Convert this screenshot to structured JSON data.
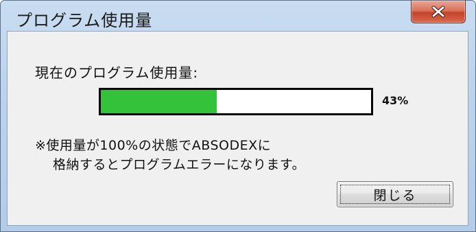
{
  "window": {
    "title": "プログラム使用量"
  },
  "usage": {
    "label": "現在のプログラム使用量:",
    "progress_fraction": 0.43,
    "percent_text": "43%",
    "fill_color": "#33c23a"
  },
  "note": {
    "line1": "※使用量が100%の状態でABSODEXに",
    "line2": "格納するとプログラムエラーになります。"
  },
  "buttons": {
    "close_label": "閉じる"
  },
  "icons": {
    "title_close": "close-icon"
  }
}
